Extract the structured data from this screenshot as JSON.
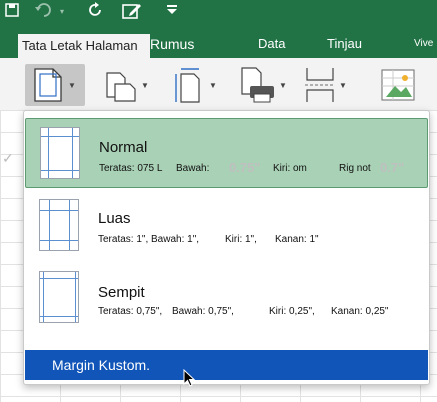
{
  "ribbon": {
    "tabs": {
      "active": "Tata Letak Halaman",
      "rumus": "Rumus",
      "data": "Data",
      "tinjau": "Tinjau",
      "vive": "Vive"
    },
    "accent_color": "#217346",
    "qat_icons": [
      "save-icon",
      "undo-icon",
      "redo-icon",
      "edit-icon",
      "customize-icon"
    ],
    "buttons": [
      "margins-icon",
      "orientation-icon",
      "size-icon",
      "print-area-icon",
      "breaks-icon",
      "background-icon"
    ]
  },
  "menu": {
    "items": [
      {
        "title": "Normal",
        "top": "Teratas: 075 L",
        "bottom": "Bawah:",
        "bottom_value": "0.75\"",
        "left": "Kiri: om",
        "right": "Rig not",
        "right_value": "0.7\""
      },
      {
        "title": "Luas",
        "top": "Teratas: 1\",",
        "bottom": "Bawah: 1\",",
        "left": "Kiri: 1\",",
        "right": "Kanan: 1\""
      },
      {
        "title": "Sempit",
        "top": "Teratas: 0,75\",",
        "bottom": "Bawah: 0,75\",",
        "left": "Kiri: 0,25\",",
        "right": "Kanan: 0,25\""
      }
    ],
    "custom_label": "Margin Kustom.",
    "highlight_color": "#1155b8"
  }
}
